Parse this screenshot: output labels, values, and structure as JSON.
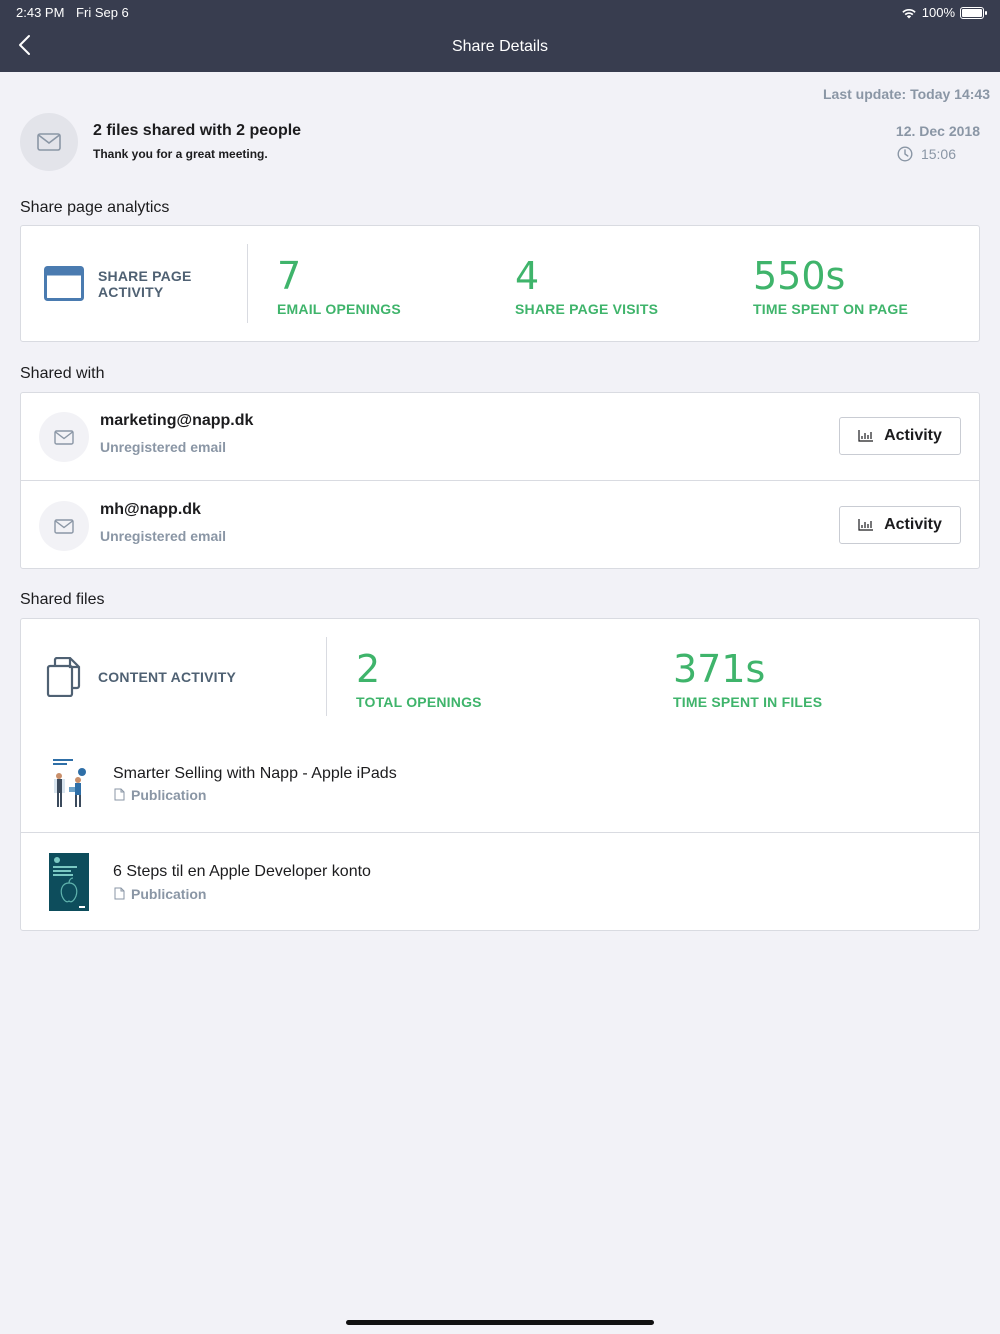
{
  "status_bar": {
    "time": "2:43 PM",
    "date": "Fri Sep 6",
    "battery": "100%"
  },
  "nav": {
    "title": "Share Details",
    "back_icon": "chevron-left-icon"
  },
  "last_update": "Last update: Today 14:43",
  "summary": {
    "title": "2 files shared with 2 people",
    "message": "Thank you for a great meeting.",
    "date": "12. Dec 2018",
    "time": "15:06"
  },
  "analytics": {
    "section_label": "Share page analytics",
    "title": "SHARE PAGE ACTIVITY",
    "title_line1": "SHARE PAGE",
    "title_line2": "ACTIVITY",
    "stats": [
      {
        "value": "7",
        "label": "EMAIL OPENINGS"
      },
      {
        "value": "4",
        "label": "SHARE PAGE VISITS"
      },
      {
        "value": "550s",
        "label": "TIME SPENT ON PAGE"
      }
    ]
  },
  "shared_with": {
    "section_label": "Shared with",
    "recipients": [
      {
        "email": "marketing@napp.dk",
        "status": "Unregistered email",
        "button": "Activity"
      },
      {
        "email": "mh@napp.dk",
        "status": "Unregistered email",
        "button": "Activity"
      }
    ]
  },
  "shared_files": {
    "section_label": "Shared files",
    "title": "CONTENT ACTIVITY",
    "stats": [
      {
        "value": "2",
        "label": "TOTAL OPENINGS"
      },
      {
        "value": "371s",
        "label": "TIME SPENT IN FILES"
      }
    ],
    "files": [
      {
        "title": "Smarter Selling with Napp - Apple iPads",
        "type": "Publication"
      },
      {
        "title": "6 Steps til en Apple Developer konto",
        "type": "Publication"
      }
    ]
  },
  "colors": {
    "header_bg": "#383d4f",
    "accent_green": "#3fb46b",
    "muted_text": "#8a96a5",
    "page_bg": "#f2f2f7"
  }
}
